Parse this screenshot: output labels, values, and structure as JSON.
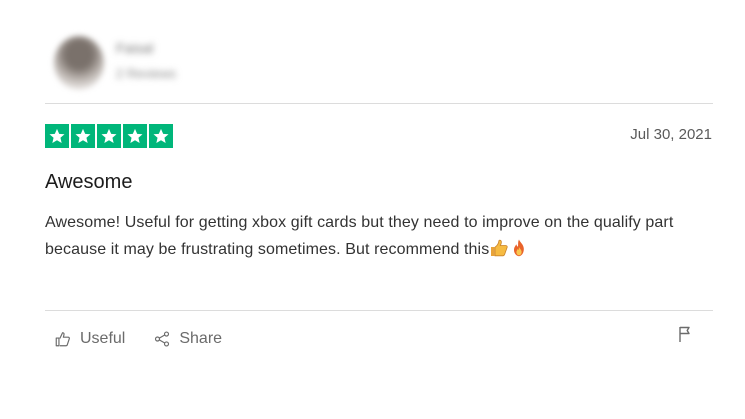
{
  "reviewer": {
    "name": "Faisal",
    "meta": "2 Reviews"
  },
  "review": {
    "rating": 5,
    "rating_max": 5,
    "date": "Jul 30, 2021",
    "title": "Awesome",
    "body": "Awesome! Useful for getting xbox gift cards but they need to improve on the qualify part because it may be frustrating sometimes. But recommend this"
  },
  "actions": {
    "useful_label": "Useful",
    "share_label": "Share"
  },
  "icons": {
    "star": "star-icon",
    "thumbs_up_emoji": "thumbs-up-emoji",
    "fire_emoji": "fire-emoji",
    "useful": "thumbs-up-icon",
    "share": "share-icon",
    "flag": "flag-icon"
  },
  "colors": {
    "star_background": "#00b67a",
    "star_color": "#ffffff",
    "text": "#333333",
    "muted": "#6b6b6b",
    "divider": "#dcdcdc"
  }
}
